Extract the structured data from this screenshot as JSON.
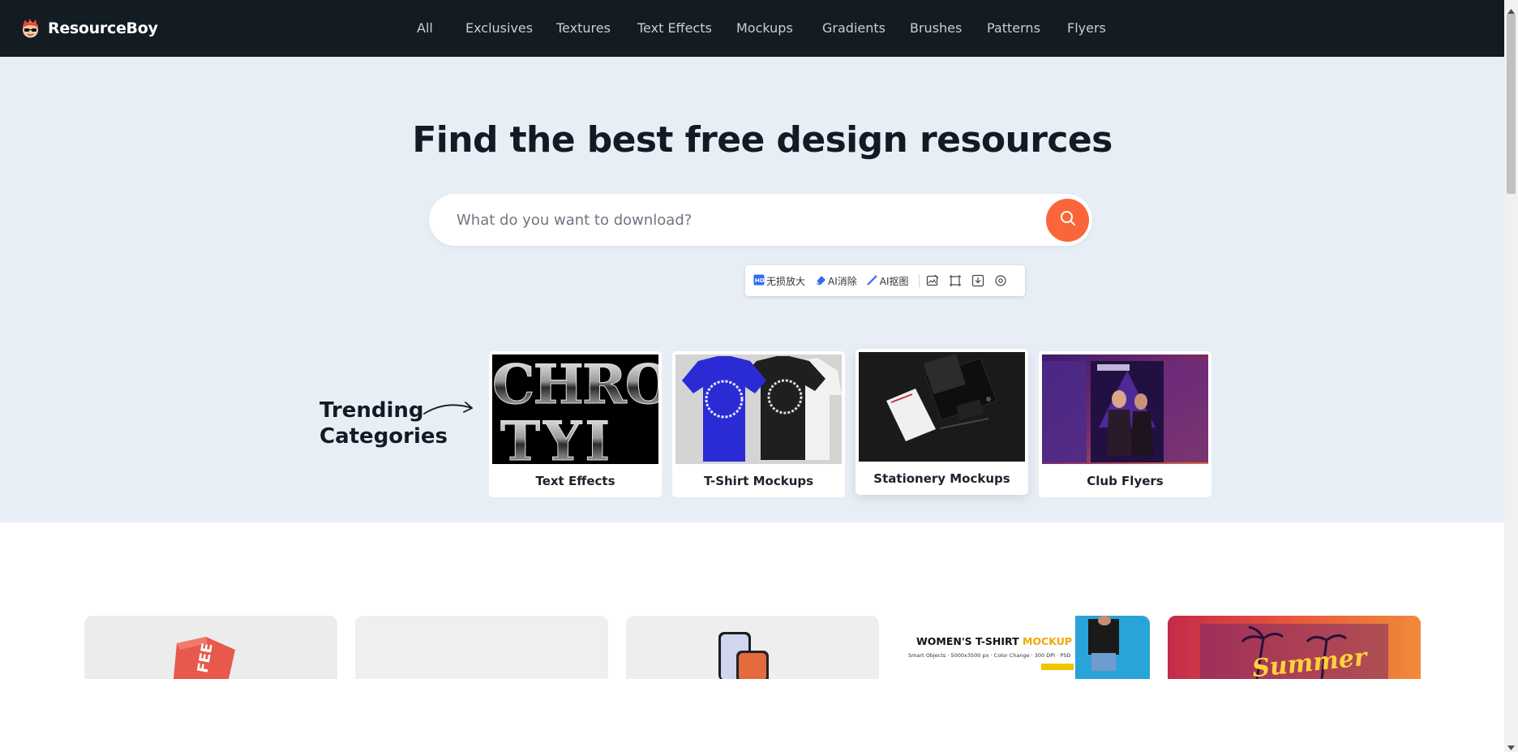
{
  "brand": {
    "name": "ResourceBoy"
  },
  "nav": {
    "items": [
      {
        "label": "All"
      },
      {
        "label": "Exclusives"
      },
      {
        "label": "Textures"
      },
      {
        "label": "Text Effects"
      },
      {
        "label": "Mockups"
      },
      {
        "label": "Gradients"
      },
      {
        "label": "Brushes"
      },
      {
        "label": "Patterns"
      },
      {
        "label": "Flyers"
      }
    ]
  },
  "hero": {
    "title": "Find the best free design resources",
    "search_placeholder": "What do you want to download?"
  },
  "ai_toolbar": {
    "upscale": "无损放大",
    "erase": "AI消除",
    "cutout": "AI抠图"
  },
  "trending": {
    "label_line1": "Trending",
    "label_line2": "Categories",
    "cards": [
      {
        "label": "Text Effects",
        "image_text": "CHRO TYI"
      },
      {
        "label": "T-Shirt Mockups"
      },
      {
        "label": "Stationery Mockups"
      },
      {
        "label": "Club Flyers"
      }
    ]
  },
  "thumbs": {
    "coffee_text": "FEE",
    "tshirt_title_1": "WOMEN'S T-SHIRT ",
    "tshirt_title_2": "MOCKUP",
    "tshirt_sub": "Smart Objects · 5000x3500 px · Color Change · 300 DPI · PSD",
    "summer_text": "Summer"
  },
  "colors": {
    "navbar": "#131b23",
    "hero_bg": "#e8eef5",
    "accent": "#fa6639"
  }
}
